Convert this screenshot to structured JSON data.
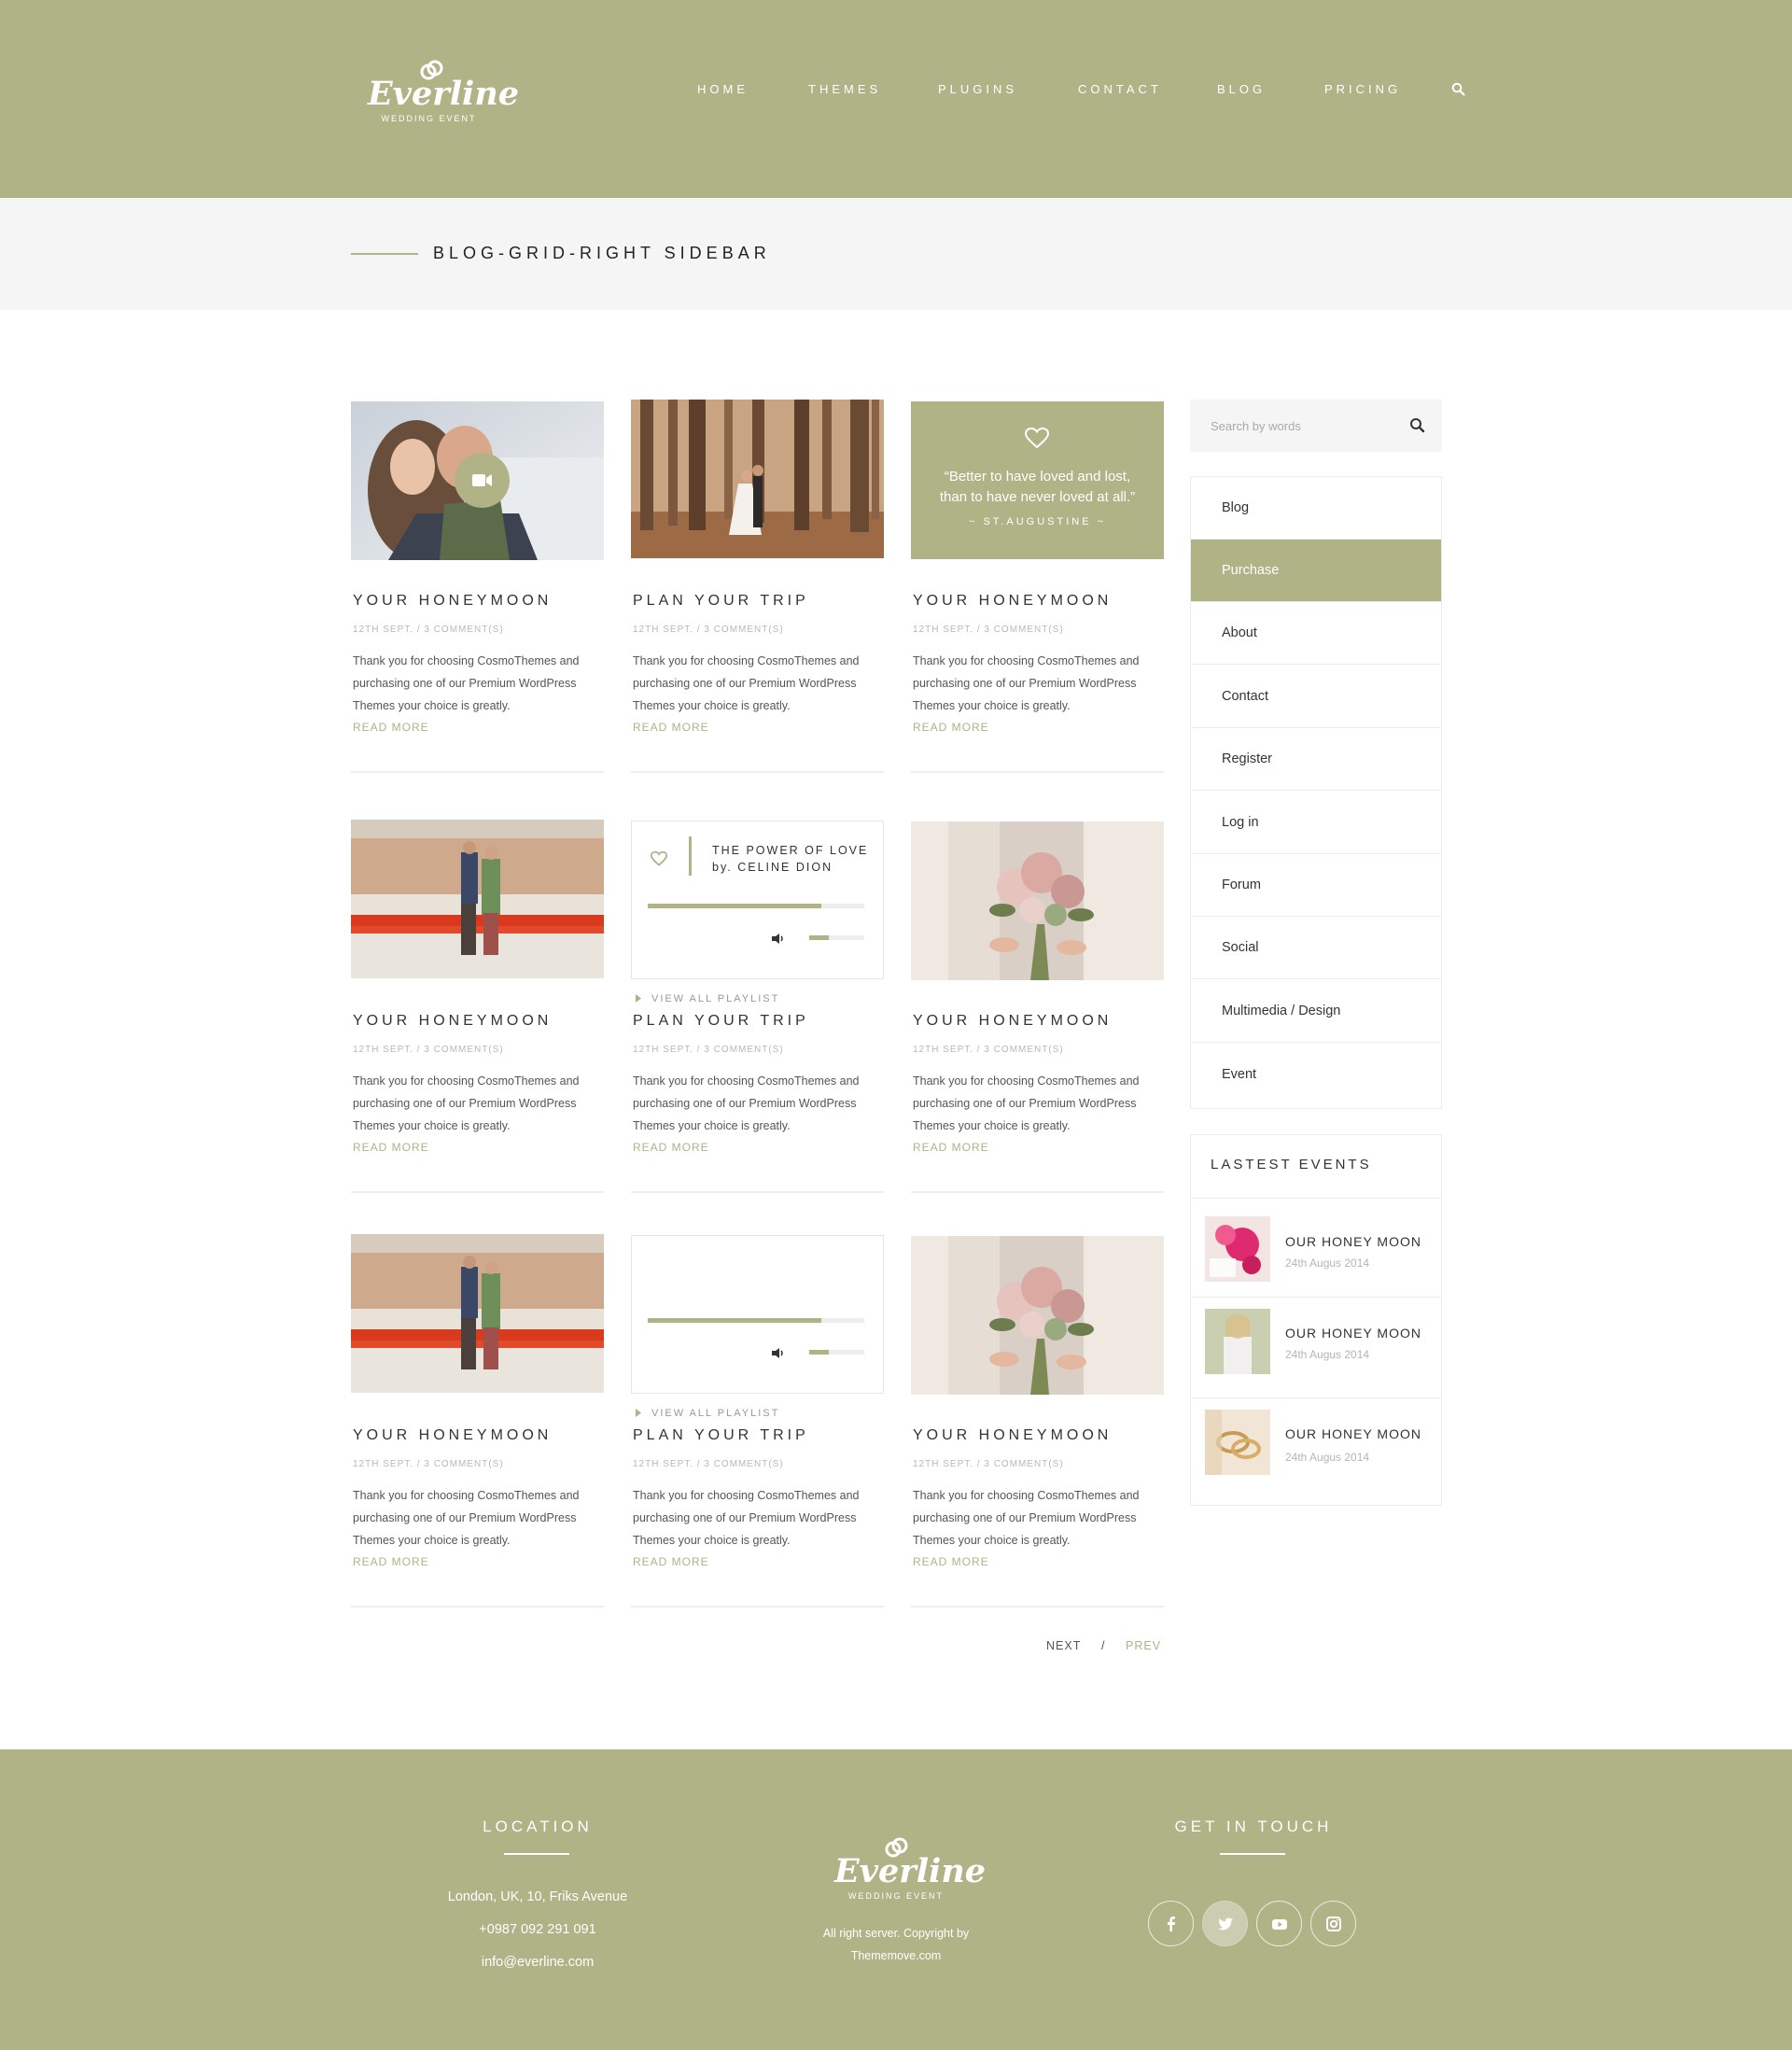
{
  "brand": {
    "name": "Everline",
    "tagline": "WEDDING EVENT"
  },
  "nav": {
    "home": "HOME",
    "themes": "THEMES",
    "plugins": "PLUGINS",
    "contact": "CONTACT",
    "blog": "BLOG",
    "pricing": "PRICING"
  },
  "page_title": "BLOG-GRID-RIGHT SIDEBAR",
  "posts": [
    {
      "title": "YOUR HONEYMOON",
      "meta": "12TH SEPT. / 3 COMMENT(S)",
      "line1": "Thank you for choosing CosmoThemes and",
      "line2": "purchasing one of our Premium WordPress",
      "line3": "Themes your choice is greatly.",
      "read_more": "READ MORE"
    },
    {
      "title": "PLAN YOUR TRIP",
      "meta": "12TH SEPT. / 3 COMMENT(S)",
      "line1": "Thank you for choosing CosmoThemes and",
      "line2": "purchasing one of our Premium WordPress",
      "line3": "Themes your choice is greatly.",
      "read_more": "READ MORE"
    },
    {
      "title": "YOUR HONEYMOON",
      "meta": "12TH SEPT. / 3 COMMENT(S)",
      "line1": "Thank you for choosing CosmoThemes and",
      "line2": "purchasing one of our Premium WordPress",
      "line3": "Themes your choice is greatly.",
      "read_more": "READ MORE"
    },
    {
      "title": "YOUR HONEYMOON",
      "meta": "12TH SEPT. / 3 COMMENT(S)",
      "line1": "Thank you for choosing CosmoThemes and",
      "line2": "purchasing one of our Premium WordPress",
      "line3": "Themes your choice is greatly.",
      "read_more": "READ MORE"
    },
    {
      "title": "PLAN YOUR TRIP",
      "meta": "12TH SEPT. / 3 COMMENT(S)",
      "line1": "Thank you for choosing CosmoThemes and",
      "line2": "purchasing one of our Premium WordPress",
      "line3": "Themes your choice is greatly.",
      "read_more": "READ MORE"
    },
    {
      "title": "YOUR HONEYMOON",
      "meta": "12TH SEPT. / 3 COMMENT(S)",
      "line1": "Thank you for choosing CosmoThemes and",
      "line2": "purchasing one of our Premium WordPress",
      "line3": "Themes your choice is greatly.",
      "read_more": "READ MORE"
    },
    {
      "title": "YOUR HONEYMOON",
      "meta": "12TH SEPT. / 3 COMMENT(S)",
      "line1": "Thank you for choosing CosmoThemes and",
      "line2": "purchasing one of our Premium WordPress",
      "line3": "Themes your choice is greatly.",
      "read_more": "READ MORE"
    },
    {
      "title": "PLAN YOUR TRIP",
      "meta": "12TH SEPT. / 3 COMMENT(S)",
      "line1": "Thank you for choosing CosmoThemes and",
      "line2": "purchasing one of our Premium WordPress",
      "line3": "Themes your choice is greatly.",
      "read_more": "READ MORE"
    },
    {
      "title": "YOUR HONEYMOON",
      "meta": "12TH SEPT. / 3 COMMENT(S)",
      "line1": "Thank you for choosing CosmoThemes and",
      "line2": "purchasing one of our Premium WordPress",
      "line3": "Themes your choice is greatly.",
      "read_more": "READ MORE"
    }
  ],
  "quote": {
    "line1": "“Better to have loved and lost,",
    "line2": "than to have never loved at all.”",
    "author": "~ ST.AUGUSTINE ~"
  },
  "audio": {
    "title_line1": "THE POWER OF LOVE",
    "title_line2": "by. CELINE DION",
    "progress": 0.8,
    "volume": 0.35,
    "playlist_label": "VIEW ALL PLAYLIST"
  },
  "sidebar": {
    "search_placeholder": "Search by words",
    "categories": [
      "Blog",
      "Purchase",
      "About",
      "Contact",
      "Register",
      "Log in",
      "Forum",
      "Social",
      "Multimedia / Design",
      "Event"
    ],
    "active_category": "Purchase",
    "events_title": "LASTEST EVENTS",
    "events": [
      {
        "title": "OUR HONEY MOON",
        "date": "24th Augus 2014"
      },
      {
        "title": "OUR HONEY MOON",
        "date": "24th Augus 2014"
      },
      {
        "title": "OUR HONEY MOON",
        "date": "24th Augus 2014"
      }
    ]
  },
  "pager": {
    "next": "NEXT",
    "sep": "/",
    "prev": "PREV"
  },
  "footer": {
    "location_title": "LOCATION",
    "address": "London, UK, 10, Friks Avenue",
    "phone": "+0987 092 291 091",
    "email": "info@everline.com",
    "copyright_line1": "All right server. Copyright by",
    "copyright_line2": "Thememove.com",
    "touch_title": "GET IN TOUCH",
    "social_icons": [
      "facebook-icon",
      "twitter-icon",
      "youtube-icon",
      "instagram-icon"
    ]
  },
  "colors": {
    "accent": "#afb386",
    "band": "#f5f5f5",
    "text": "#333333"
  }
}
